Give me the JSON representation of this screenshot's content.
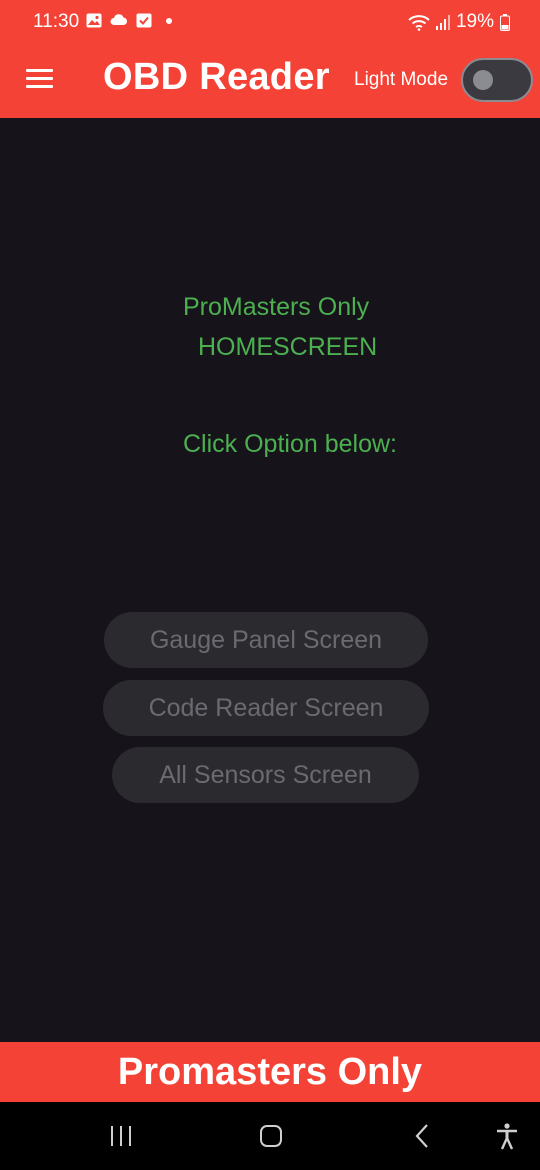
{
  "status_bar": {
    "time": "11:30",
    "battery": "19%",
    "icons": [
      "image-icon",
      "cloud-icon",
      "checkbox-icon",
      "dot-icon",
      "wifi-icon",
      "signal-icon",
      "battery-icon"
    ]
  },
  "app_bar": {
    "title": "OBD Reader",
    "mode_label": "Light Mode",
    "toggle_on": false
  },
  "main": {
    "heading_line1": "ProMasters Only",
    "heading_line2": "HOMESCREEN",
    "prompt": "Click Option below:",
    "buttons": [
      {
        "label": "Gauge Panel Screen"
      },
      {
        "label": "Code Reader Screen"
      },
      {
        "label": "All Sensors Screen"
      }
    ]
  },
  "footer": {
    "text": "Promasters Only"
  },
  "colors": {
    "accent": "#f44336",
    "background": "#16141a",
    "green_text": "#4caf50",
    "button_bg": "#2b2a2f",
    "button_text": "#6b6a70"
  }
}
